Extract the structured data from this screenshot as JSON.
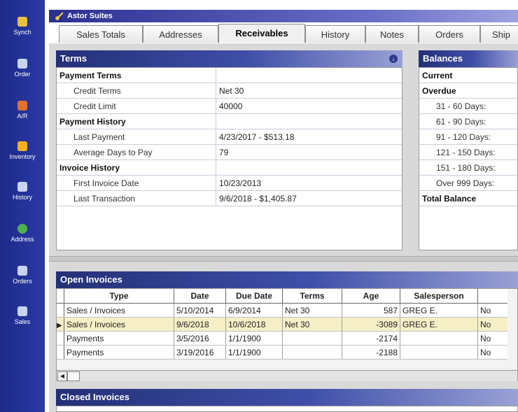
{
  "sidebar": {
    "items": [
      {
        "label": "Synch",
        "icon": "synch-icon",
        "color": "#e8c040"
      },
      {
        "label": "Order",
        "icon": "order-icon",
        "color": "#c9d4f0"
      },
      {
        "label": "A/R",
        "icon": "ar-icon",
        "color": "#e07030"
      },
      {
        "label": "Inventory",
        "icon": "inventory-icon",
        "color": "#f0b020"
      },
      {
        "label": "History",
        "icon": "history-icon",
        "color": "#c9d4f0"
      },
      {
        "label": "Address",
        "icon": "address-icon",
        "color": "#50b050"
      },
      {
        "label": "Orders",
        "icon": "orders-icon",
        "color": "#c9d4f0"
      },
      {
        "label": "Sales",
        "icon": "sales-icon",
        "color": "#c9d4f0"
      }
    ]
  },
  "window": {
    "title": "Astor Suites"
  },
  "tabs": [
    {
      "label": "Sales Totals"
    },
    {
      "label": "Addresses"
    },
    {
      "label": "Receivables"
    },
    {
      "label": "History"
    },
    {
      "label": "Notes"
    },
    {
      "label": "Orders"
    },
    {
      "label": "Ship"
    }
  ],
  "terms": {
    "title": "Terms",
    "rows": [
      {
        "label": "Payment Terms",
        "value": "",
        "group": true
      },
      {
        "label": "Credit Terms",
        "value": "Net 30",
        "group": false
      },
      {
        "label": "Credit Limit",
        "value": "40000",
        "group": false
      },
      {
        "label": "Payment History",
        "value": "",
        "group": true
      },
      {
        "label": "Last Payment",
        "value": "4/23/2017 - $513.18",
        "group": false
      },
      {
        "label": "Average Days to Pay",
        "value": "79",
        "group": false
      },
      {
        "label": "Invoice History",
        "value": "",
        "group": true
      },
      {
        "label": "First Invoice Date",
        "value": "10/23/2013",
        "group": false
      },
      {
        "label": "Last Transaction",
        "value": "9/6/2018 - $1,405.87",
        "group": false
      }
    ]
  },
  "balances": {
    "title": "Balances",
    "rows": [
      {
        "label": "Current",
        "group": true
      },
      {
        "label": "Overdue",
        "group": true
      },
      {
        "label": "31 - 60 Days:",
        "group": false
      },
      {
        "label": "61 - 90 Days:",
        "group": false
      },
      {
        "label": "91 - 120 Days:",
        "group": false
      },
      {
        "label": "121 - 150 Days:",
        "group": false
      },
      {
        "label": "151 - 180 Days:",
        "group": false
      },
      {
        "label": "Over 999 Days:",
        "group": false
      },
      {
        "label": "Total Balance",
        "group": true
      }
    ]
  },
  "open_invoices": {
    "title": "Open Invoices",
    "columns": [
      "Type",
      "Date",
      "Due Date",
      "Terms",
      "Age",
      "Salesperson",
      ""
    ],
    "rows": [
      {
        "type": "Sales / Invoices",
        "date": "5/10/2014",
        "due": "6/9/2014",
        "terms": "Net 30",
        "age": "587",
        "sales": "GREG E.",
        "flag": "No"
      },
      {
        "type": "Sales / Invoices",
        "date": "9/6/2018",
        "due": "10/6/2018",
        "terms": "Net 30",
        "age": "-3089",
        "sales": "GREG E.",
        "flag": "No"
      },
      {
        "type": "Payments",
        "date": "3/5/2016",
        "due": "1/1/1900",
        "terms": "",
        "age": "-2174",
        "sales": "",
        "flag": "No"
      },
      {
        "type": "Payments",
        "date": "3/19/2016",
        "due": "1/1/1900",
        "terms": "",
        "age": "-2188",
        "sales": "",
        "flag": "No"
      }
    ]
  },
  "closed_invoices": {
    "title": "Closed Invoices"
  }
}
